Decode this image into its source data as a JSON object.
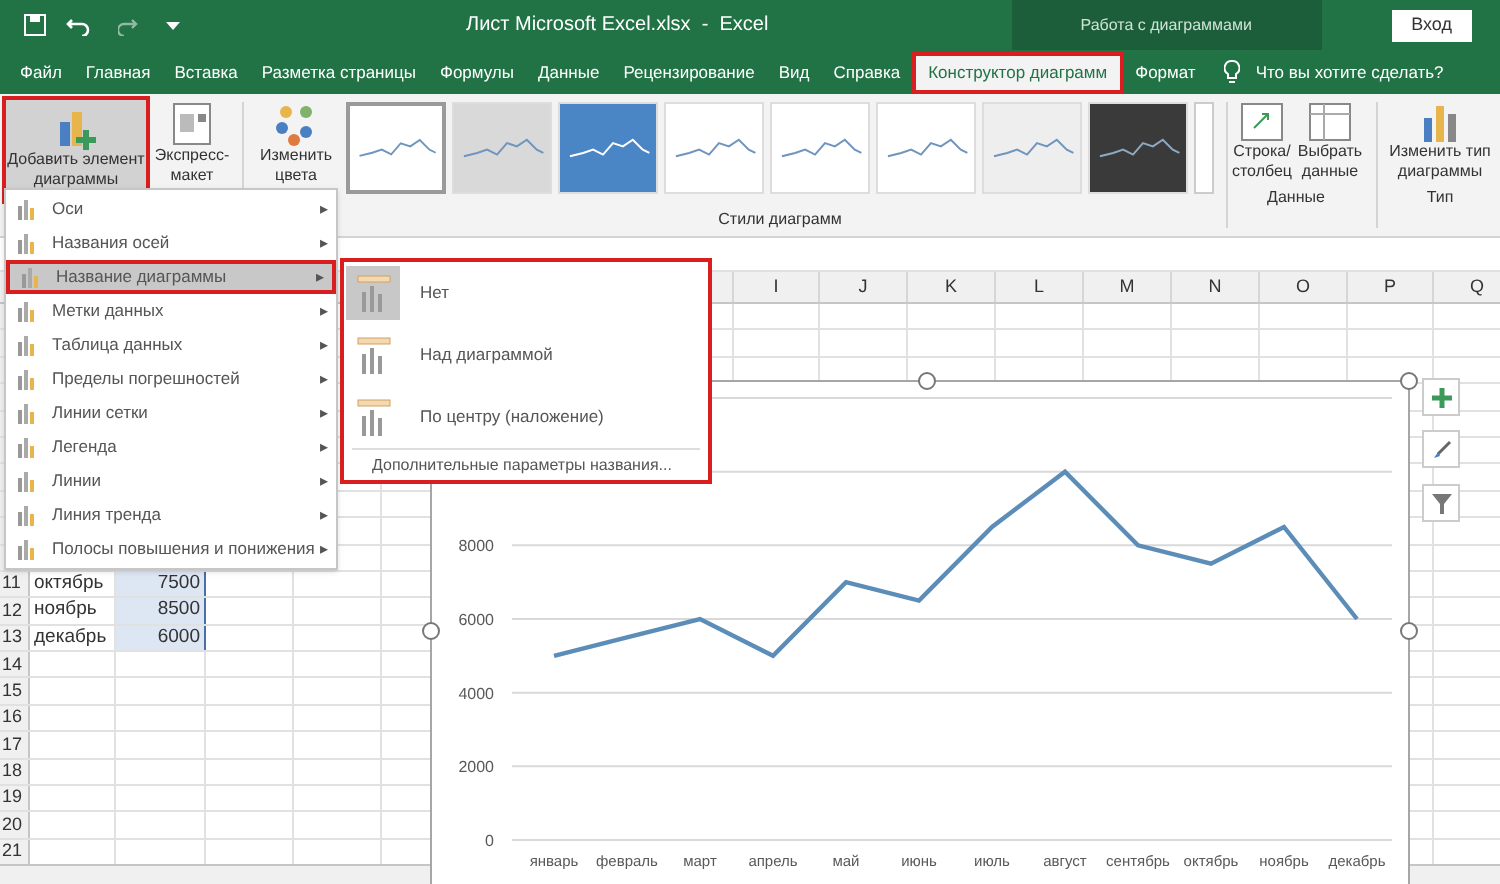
{
  "title_bar": {
    "title": "Лист Microsoft Excel.xlsx  -  Excel",
    "context_label": "Работа с диаграммами",
    "sign_in": "Вход"
  },
  "tabs": [
    {
      "label": "Файл",
      "selected": false,
      "highlighted": false
    },
    {
      "label": "Главная",
      "selected": false,
      "highlighted": false
    },
    {
      "label": "Вставка",
      "selected": false,
      "highlighted": false
    },
    {
      "label": "Разметка страницы",
      "selected": false,
      "highlighted": false
    },
    {
      "label": "Формулы",
      "selected": false,
      "highlighted": false
    },
    {
      "label": "Данные",
      "selected": false,
      "highlighted": false
    },
    {
      "label": "Рецензирование",
      "selected": false,
      "highlighted": false
    },
    {
      "label": "Вид",
      "selected": false,
      "highlighted": false
    },
    {
      "label": "Справка",
      "selected": false,
      "highlighted": false
    },
    {
      "label": "Конструктор диаграмм",
      "selected": true,
      "highlighted": true
    },
    {
      "label": "Формат",
      "selected": false,
      "highlighted": false
    }
  ],
  "tell_me": "Что вы хотите сделать?",
  "ribbon": {
    "add_element": {
      "label": "Добавить элемент диаграммы",
      "highlighted": true
    },
    "quick_layout": "Экспресс-макет",
    "change_colors": "Изменить цвета",
    "styles": [
      {
        "kind": "light",
        "selected": true
      },
      {
        "kind": "gray",
        "selected": false
      },
      {
        "kind": "blue",
        "selected": false
      },
      {
        "kind": "light",
        "selected": false
      },
      {
        "kind": "light",
        "selected": false
      },
      {
        "kind": "light",
        "selected": false
      },
      {
        "kind": "hatched",
        "selected": false
      },
      {
        "kind": "dark",
        "selected": false
      }
    ],
    "styles_label": "Стили диаграмм",
    "switch_row_col": "Строка/ столбец",
    "select_data": "Выбрать данные",
    "data_label": "Данные",
    "change_type": "Изменить тип диаграммы",
    "type_label": "Тип"
  },
  "columns": [
    "I",
    "J",
    "K",
    "L",
    "M",
    "N",
    "O",
    "P",
    "Q"
  ],
  "rows": [
    {
      "header": "11",
      "label": "октябрь",
      "value": "7500",
      "in_range": true
    },
    {
      "header": "12",
      "label": "ноябрь",
      "value": "8500",
      "in_range": true
    },
    {
      "header": "13",
      "label": "декабрь",
      "value": "6000",
      "in_range": true
    },
    {
      "header": "14",
      "in_range": false
    },
    {
      "header": "15",
      "in_range": false
    },
    {
      "header": "16",
      "in_range": false
    },
    {
      "header": "17",
      "in_range": false
    },
    {
      "header": "18",
      "in_range": false
    },
    {
      "header": "19",
      "in_range": false
    },
    {
      "header": "20",
      "in_range": false
    },
    {
      "header": "21",
      "in_range": false
    }
  ],
  "menu": {
    "items": [
      {
        "label": "Оси",
        "selected": false
      },
      {
        "label": "Названия осей",
        "selected": false
      },
      {
        "label": "Название диаграммы",
        "selected": true
      },
      {
        "label": "Метки данных",
        "selected": false
      },
      {
        "label": "Таблица данных",
        "selected": false
      },
      {
        "label": "Пределы погрешностей",
        "selected": false
      },
      {
        "label": "Линии сетки",
        "selected": false
      },
      {
        "label": "Легенда",
        "selected": false
      },
      {
        "label": "Линии",
        "selected": false
      },
      {
        "label": "Линия тренда",
        "selected": false
      },
      {
        "label": "Полосы повышения и понижения",
        "selected": false
      }
    ],
    "arrow": "▸"
  },
  "submenu": {
    "highlighted": true,
    "options": [
      {
        "label": "Нет",
        "selected": true
      },
      {
        "label": "Над диаграммой",
        "selected": false
      },
      {
        "label": "По центру (наложение)",
        "selected": false
      }
    ],
    "more": "Дополнительные параметры названия..."
  },
  "chart": {
    "chart_data": {
      "type": "line",
      "categories": [
        "январь",
        "февраль",
        "март",
        "апрель",
        "май",
        "июнь",
        "июль",
        "август",
        "сентябрь",
        "октябрь",
        "ноябрь",
        "декабрь"
      ],
      "series": [
        {
          "color": "#5b8db8",
          "values": [
            5000,
            5500,
            6000,
            5000,
            7000,
            6500,
            8500,
            10000,
            8000,
            7500,
            8500,
            6000
          ]
        }
      ],
      "ylim": [
        0,
        12000
      ],
      "grid": true,
      "yticks": [
        0,
        2000,
        4000,
        6000,
        8000
      ]
    }
  }
}
